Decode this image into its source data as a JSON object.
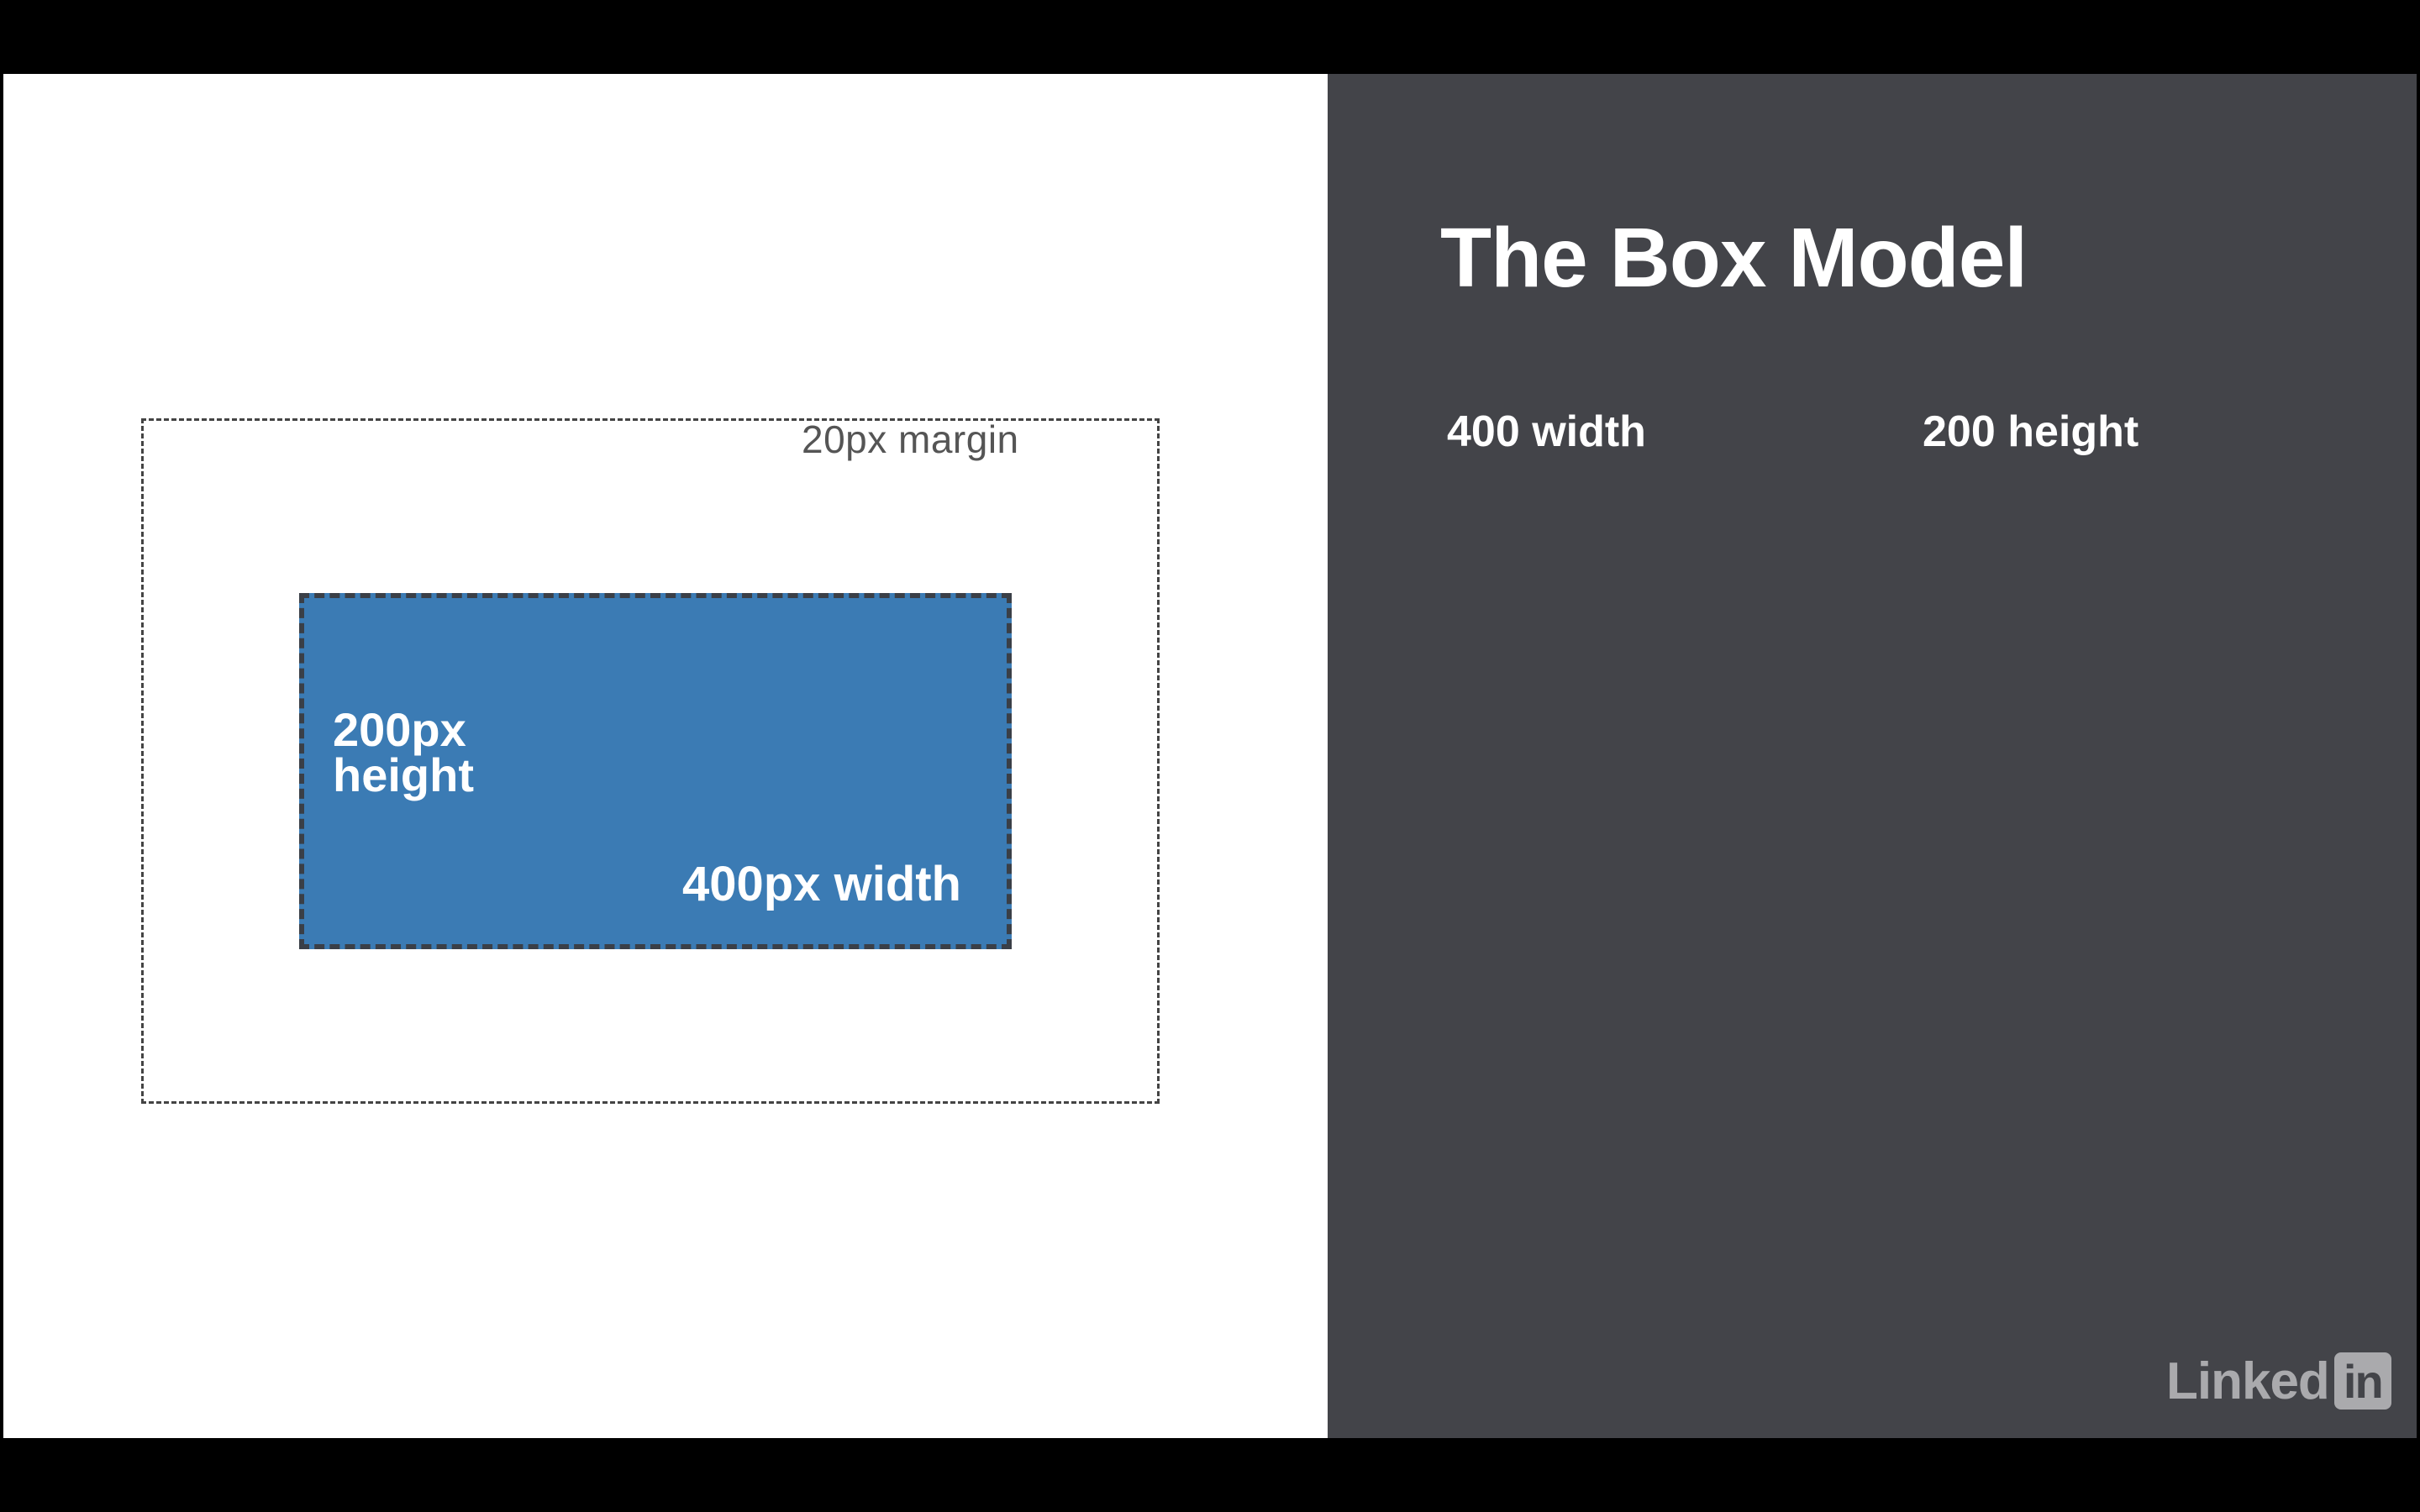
{
  "colors": {
    "right_panel_bg": "#434449",
    "content_box_fill": "#3b7bb4",
    "left_panel_bg": "#ffffff",
    "letterbox": "#000000"
  },
  "diagram": {
    "margin_label": "20px margin",
    "height_label_line1": "200px",
    "height_label_line2": "height",
    "width_label": "400px width"
  },
  "panel": {
    "title": "The Box Model",
    "prop_width": "400 width",
    "prop_height": "200 height"
  },
  "watermark": {
    "text": "Linked",
    "badge": "in",
    "icon": "linkedin-logo-icon"
  }
}
